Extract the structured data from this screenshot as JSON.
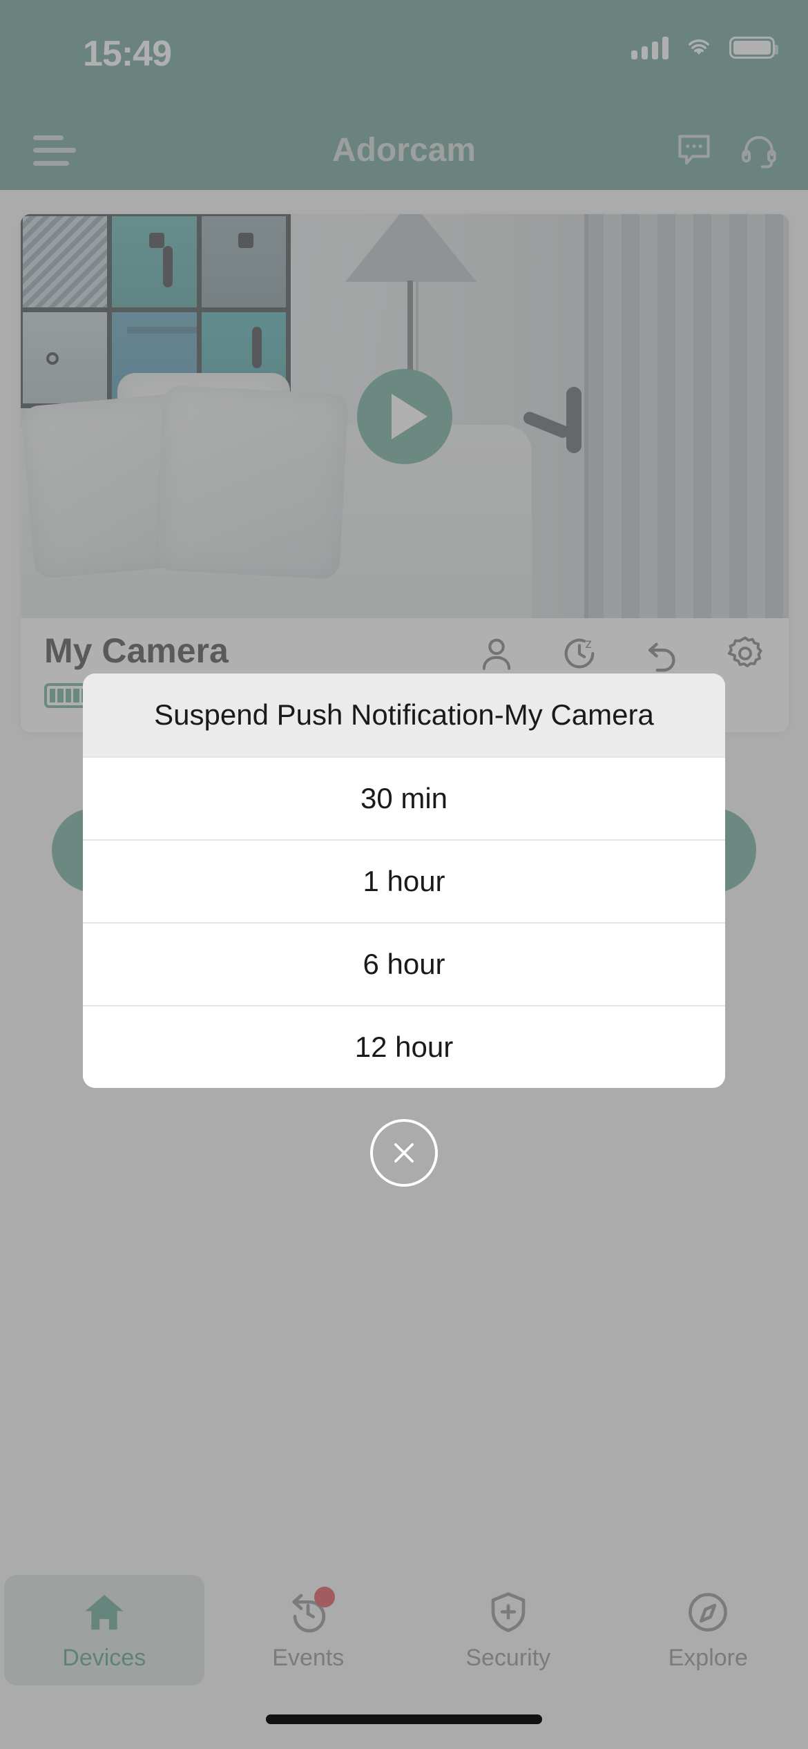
{
  "status_bar": {
    "time": "15:49",
    "signal_icon": "cellular-signal-icon",
    "wifi_icon": "wifi-icon",
    "battery_icon": "battery-icon"
  },
  "header": {
    "title": "Adorcam",
    "menu_icon": "hamburger-menu-icon",
    "message_icon": "message-bubble-icon",
    "support_icon": "headset-support-icon"
  },
  "camera_card": {
    "name": "My Camera",
    "play_icon": "play-icon",
    "battery_icon": "battery-full-icon",
    "actions": [
      {
        "icon": "person-detection-icon",
        "name": "person-detection-button"
      },
      {
        "icon": "sleep-mode-icon",
        "name": "sleep-mode-button"
      },
      {
        "icon": "replay-icon",
        "name": "replay-button"
      },
      {
        "icon": "gear-icon",
        "name": "settings-button"
      }
    ]
  },
  "quick_actions": {
    "left_icon": "quick-action-left",
    "right_icon": "quick-action-right"
  },
  "modal": {
    "title": "Suspend Push Notification-My Camera",
    "options": [
      {
        "label": "30 min"
      },
      {
        "label": "1 hour"
      },
      {
        "label": "6 hour"
      },
      {
        "label": "12 hour"
      }
    ],
    "close_icon": "close-icon"
  },
  "tabbar": {
    "items": [
      {
        "label": "Devices",
        "icon": "home-icon",
        "active": true,
        "badge": false
      },
      {
        "label": "Events",
        "icon": "replay-clock-icon",
        "active": false,
        "badge": true
      },
      {
        "label": "Security",
        "icon": "shield-plus-icon",
        "active": false,
        "badge": false
      },
      {
        "label": "Explore",
        "icon": "compass-icon",
        "active": false,
        "badge": false
      }
    ]
  },
  "colors": {
    "brand_green": "#478a7d",
    "accent_green": "#4a9a82",
    "active_tab_text": "#2e8668",
    "badge_red": "#d8232a",
    "modal_header_bg": "#ebebeb",
    "dim_overlay": "rgba(128,128,128,0.62)"
  }
}
